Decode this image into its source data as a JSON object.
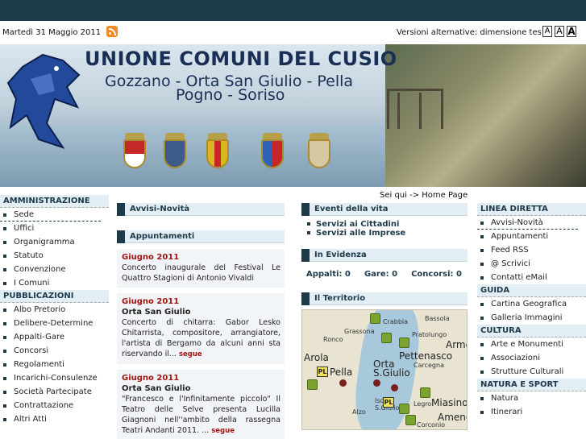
{
  "header": {
    "date": "Martedì 31 Maggio 2011",
    "alt_versions_label": "Versioni alternative: dimensione testo",
    "font_sizes": [
      "A",
      "A",
      "A"
    ]
  },
  "banner": {
    "title": "UNIONE COMUNI DEL CUSIO",
    "subtitle_line1": "Gozzano - Orta San Giulio - Pella",
    "subtitle_line2": "Pogno - Soriso"
  },
  "breadcrumb": "Sei qui -> Home Page",
  "left_menu": {
    "sections": [
      {
        "title": "AMMINISTRAZIONE",
        "items": [
          "Sede",
          "Uffici",
          "Organigramma",
          "Statuto",
          "Convenzione",
          "I Comuni"
        ]
      },
      {
        "title": "PUBBLICAZIONI",
        "items": [
          "Albo Pretorio",
          "Delibere-Determine",
          "Appalti-Gare",
          "Concorsi",
          "Regolamenti",
          "Incarichi-Consulenze",
          "Società Partecipate",
          "Contrattazione",
          "Altri Atti"
        ]
      }
    ]
  },
  "center": {
    "news_title": "Avvisi-Novità",
    "appointments_title": "Appuntamenti",
    "appointments": [
      {
        "month": "Giugno 2011",
        "location": "",
        "text": "Concerto inaugurale del Festival Le Quattro Stagioni di Antonio Vivaldi",
        "more": ""
      },
      {
        "month": "Giugno 2011",
        "location": "Orta San Giulio",
        "text": "Concerto di chitarra: Gabor Lesko Chitarrista, compositore, arrangiatore, l'artista di Bergamo da alcuni anni sta riservando il...",
        "more": "segue"
      },
      {
        "month": "Giugno 2011",
        "location": "Orta San Giulio",
        "text": "\"Francesco e l'Infinitamente piccolo\" Il Teatro delle Selve presenta Lucilla Giagnoni nell''ambito della rassegna Teatri Andanti 2011. ...",
        "more": "segue"
      }
    ]
  },
  "center2": {
    "events_title": "Eventi della vita",
    "events": [
      "Servizi ai Cittadini",
      "Servizi alle Imprese"
    ],
    "evidence_title": "In Evidenza",
    "counts": [
      "Appalti: 0",
      "Gare: 0",
      "Concorsi: 0"
    ],
    "territory_title": "Il Territorio",
    "map_labels": [
      "Crabbia",
      "Bassola",
      "Ronco",
      "Grassona",
      "Pratolungo",
      "Arola",
      "Pella",
      "Orta S.Giulio",
      "Pettenasco",
      "Carcegna",
      "Armeno",
      "Isola S.Giulio",
      "Miasino",
      "Legro",
      "Alzo",
      "Ameno",
      "Corconio",
      "PL"
    ]
  },
  "right_menu": {
    "sections": [
      {
        "title": "LINEA DIRETTA",
        "items": [
          "Avvisi-Novità",
          "Appuntamenti",
          "Feed RSS",
          "@ Scrivici",
          "Contatti eMail"
        ]
      },
      {
        "title": "GUIDA",
        "items": [
          "Cartina Geografica",
          "Galleria Immagini"
        ]
      },
      {
        "title": "CULTURA",
        "items": [
          "Arte e Monumenti",
          "Associazioni",
          "Strutture Culturali"
        ]
      },
      {
        "title": "NATURA E SPORT",
        "items": [
          "Natura",
          "Itinerari"
        ]
      }
    ]
  }
}
